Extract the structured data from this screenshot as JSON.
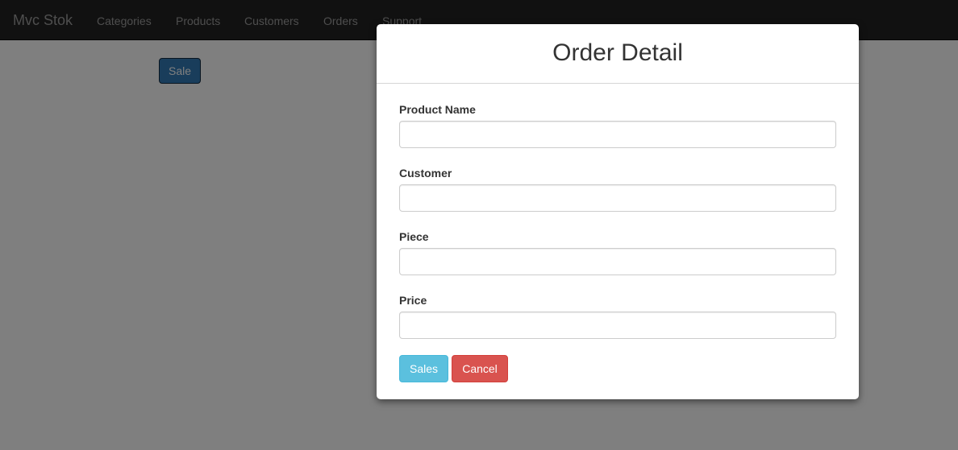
{
  "navbar": {
    "brand": "Mvc Stok",
    "links": [
      "Categories",
      "Products",
      "Customers",
      "Orders",
      "Support"
    ]
  },
  "page": {
    "sale_button_label": "Sale"
  },
  "modal": {
    "title": "Order Detail",
    "fields": [
      {
        "label": "Product Name",
        "value": ""
      },
      {
        "label": "Customer",
        "value": ""
      },
      {
        "label": "Piece",
        "value": ""
      },
      {
        "label": "Price",
        "value": ""
      }
    ],
    "sales_button_label": "Sales",
    "cancel_button_label": "Cancel"
  },
  "colors": {
    "navbar_bg": "#222222",
    "primary": "#337ab7",
    "info": "#5bc0de",
    "danger": "#d9534f"
  }
}
